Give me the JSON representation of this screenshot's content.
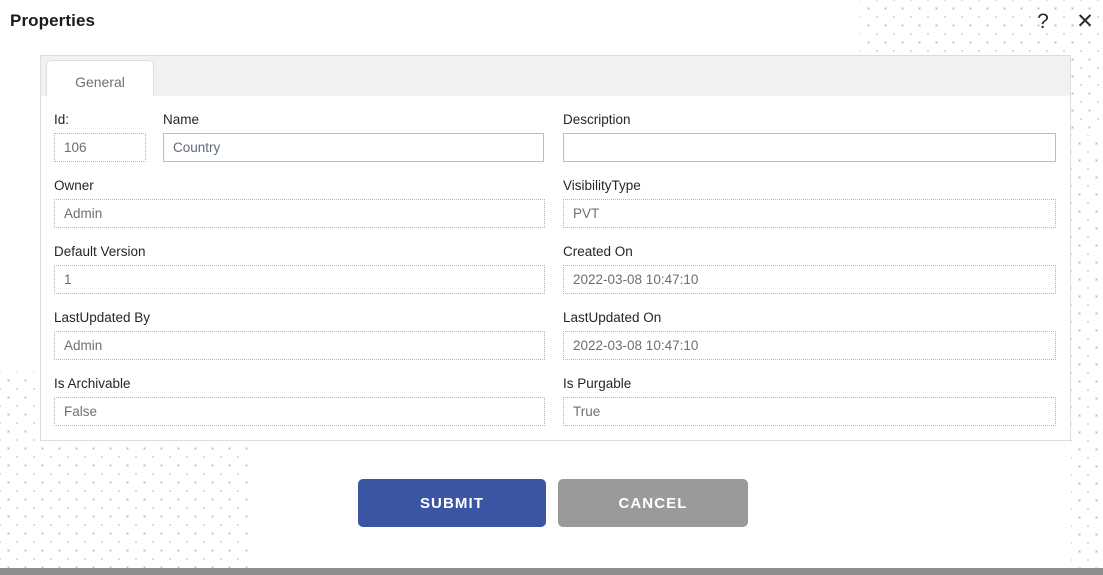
{
  "header": {
    "title": "Properties",
    "help_icon": "question-mark-icon",
    "help_glyph": "?",
    "close_icon": "close-icon",
    "close_glyph": "✕"
  },
  "tabs": [
    {
      "label": "General",
      "active": true
    }
  ],
  "form": {
    "rows": [
      {
        "left": {
          "label": "Id:",
          "value": "106",
          "readonly": true
        },
        "right": {
          "label": "Name",
          "value": "Country",
          "readonly": false
        }
      },
      {
        "left": {
          "label": "Owner",
          "value": "Admin",
          "readonly": true
        },
        "right": {
          "label": "VisibilityType",
          "value": "PVT",
          "readonly": true
        }
      },
      {
        "left": {
          "label": "Default Version",
          "value": "1",
          "readonly": true
        },
        "right": {
          "label": "Created On",
          "value": "2022-03-08 10:47:10",
          "readonly": true
        }
      },
      {
        "left": {
          "label": "LastUpdated By",
          "value": "Admin",
          "readonly": true
        },
        "right": {
          "label": "LastUpdated On",
          "value": "2022-03-08 10:47:10",
          "readonly": true
        }
      },
      {
        "left": {
          "label": "Is Archivable",
          "value": "False",
          "readonly": true
        },
        "right": {
          "label": "Is Purgable",
          "value": "True",
          "readonly": true
        }
      }
    ],
    "description": {
      "label": "Description",
      "value": "",
      "readonly": false
    }
  },
  "buttons": {
    "submit_label": "SUBMIT",
    "cancel_label": "CANCEL"
  },
  "colors": {
    "submit_blue": "#3a56a3",
    "cancel_gray": "#9a9a9a",
    "panel_border": "#dcdcdc",
    "tabbar_bg": "#f1f1f1",
    "dot_pattern": "#b9c0e4",
    "bottom_bar": "#8e8e8e"
  }
}
